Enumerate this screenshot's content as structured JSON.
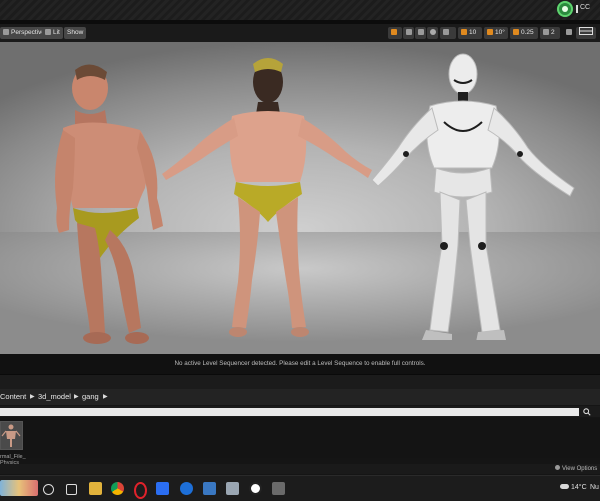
{
  "title_bar": {
    "corner_label": "CC",
    "status_color": "#2b8a3e"
  },
  "viewport_toolbar": {
    "perspective_label": "Perspective",
    "lit_label": "Lit",
    "show_label": "Show",
    "grid_snap_value": "10",
    "rotation_snap_value": "10°",
    "scale_snap_value": "0.25",
    "camera_speed_value": "2"
  },
  "viewport": {
    "message": "No active Level Sequencer detected. Please edit a Level Sequence to enable full controls.",
    "figures": [
      {
        "name": "muscular-character",
        "skin": "#c98a72",
        "briefs": "#a59a1e"
      },
      {
        "name": "tpose-character",
        "skin": "#d9a08a",
        "briefs": "#b7a825"
      },
      {
        "name": "mannequin-character",
        "body": "#ececec",
        "joints": "#1e1e1e"
      }
    ]
  },
  "content_browser": {
    "breadcrumb": [
      "Content",
      "3d_model",
      "gang"
    ],
    "search_placeholder": "",
    "assets": [
      {
        "name_line1": "rmal_File_",
        "name_line2": "Physics"
      }
    ],
    "view_options_label": "View Options"
  },
  "taskbar": {
    "weather": "14°C",
    "language": "Nu",
    "icons": [
      "wallpaper-icon",
      "search-circle-icon",
      "task-view-icon",
      "file-explorer-icon",
      "chrome-icon",
      "opera-icon",
      "malwarebytes-icon",
      "ccleaner-icon",
      "calculator-icon",
      "photos-icon",
      "unreal-engine-icon",
      "overflow-icon"
    ]
  }
}
